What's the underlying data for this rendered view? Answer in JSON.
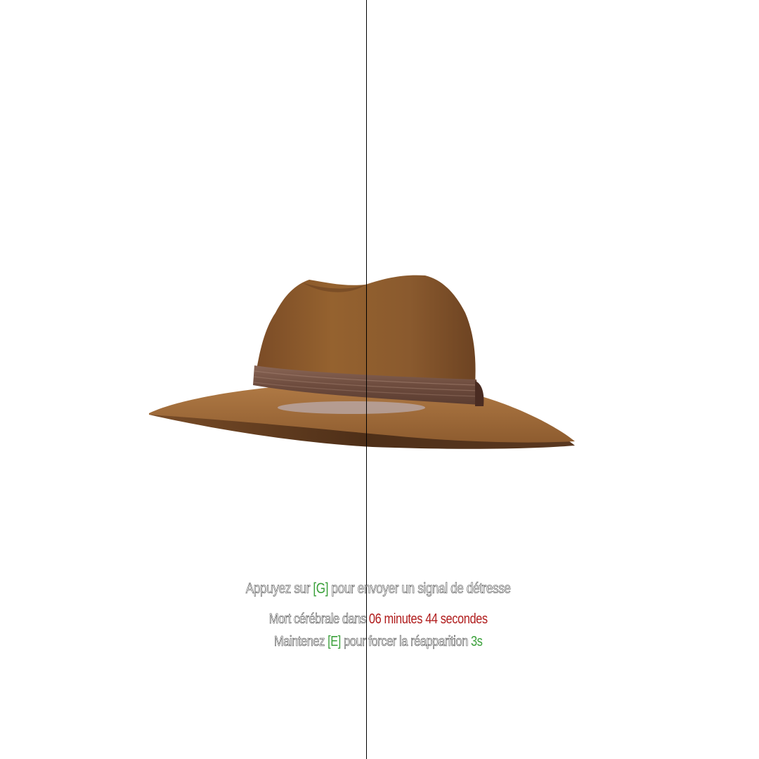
{
  "colors": {
    "background": "#ffffff",
    "key_highlight": "#3aa03a",
    "timer_red": "#b01c1c",
    "countdown_green": "#3aa03a",
    "hat_felt": "#8b5a32",
    "hat_brim": "#a06a3a",
    "hat_band": "#6e4a3a"
  },
  "scene": {
    "object": "fedora-hat"
  },
  "hud": {
    "distress": {
      "prefix": "Appuyez sur",
      "key": "[G]",
      "suffix": "pour envoyer un signal de détresse"
    },
    "brain_death": {
      "prefix": "Mort cérébrale dans",
      "timer": "06 minutes 44 secondes"
    },
    "respawn": {
      "prefix": "Maintenez",
      "key": "[E]",
      "middle": "pour forcer la réapparition",
      "countdown": "3s"
    }
  }
}
